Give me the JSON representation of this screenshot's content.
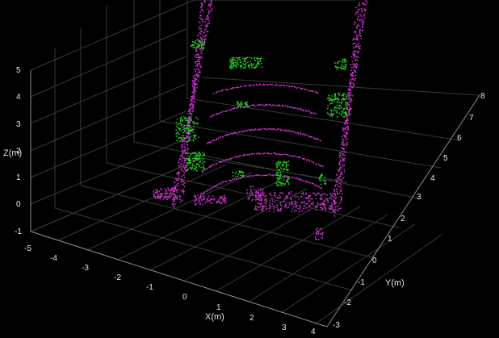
{
  "chart_data": {
    "type": "scatter",
    "title": "",
    "xlabel": "X(m)",
    "ylabel": "Y(m)",
    "zlabel": "Z(m)",
    "xticks": [
      "-5",
      "-4",
      "-3",
      "-2",
      "-1",
      "0",
      "1",
      "2",
      "3",
      "4"
    ],
    "yticks": [
      "-3",
      "-2",
      "-1",
      "0",
      "1",
      "2",
      "3",
      "4",
      "5",
      "6",
      "7",
      "8"
    ],
    "zticks": [
      "-1",
      "0",
      "1",
      "2",
      "3",
      "4",
      "5"
    ],
    "xlim": [
      -5,
      4
    ],
    "ylim": [
      -3,
      8
    ],
    "zlim": [
      -1,
      5
    ],
    "grid": true,
    "background": "#000000",
    "series": [
      {
        "color": "#cc33cc"
      },
      {
        "color": "#22cc22"
      }
    ]
  }
}
